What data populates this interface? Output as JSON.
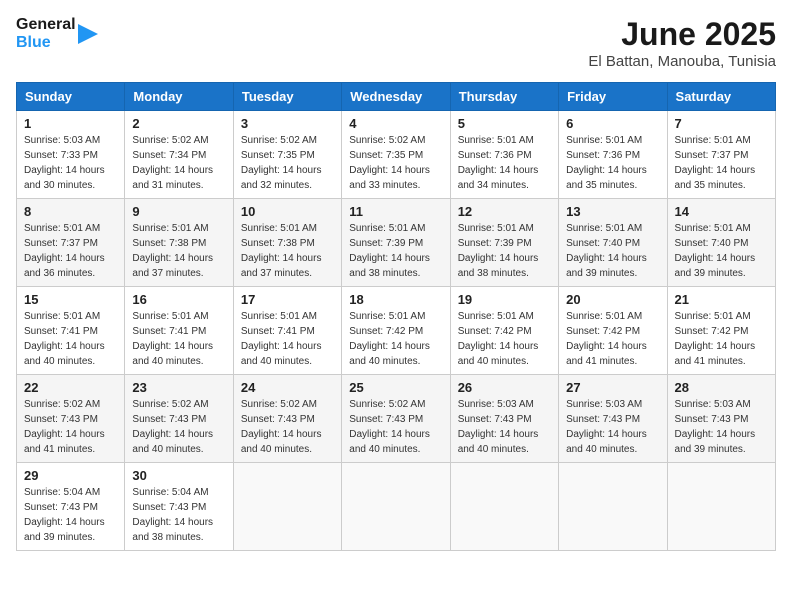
{
  "logo": {
    "line1": "General",
    "line2": "Blue"
  },
  "title": "June 2025",
  "subtitle": "El Battan, Manouba, Tunisia",
  "weekdays": [
    "Sunday",
    "Monday",
    "Tuesday",
    "Wednesday",
    "Thursday",
    "Friday",
    "Saturday"
  ],
  "weeks": [
    [
      {
        "day": "1",
        "sunrise": "5:03 AM",
        "sunset": "7:33 PM",
        "daylight": "14 hours and 30 minutes."
      },
      {
        "day": "2",
        "sunrise": "5:02 AM",
        "sunset": "7:34 PM",
        "daylight": "14 hours and 31 minutes."
      },
      {
        "day": "3",
        "sunrise": "5:02 AM",
        "sunset": "7:35 PM",
        "daylight": "14 hours and 32 minutes."
      },
      {
        "day": "4",
        "sunrise": "5:02 AM",
        "sunset": "7:35 PM",
        "daylight": "14 hours and 33 minutes."
      },
      {
        "day": "5",
        "sunrise": "5:01 AM",
        "sunset": "7:36 PM",
        "daylight": "14 hours and 34 minutes."
      },
      {
        "day": "6",
        "sunrise": "5:01 AM",
        "sunset": "7:36 PM",
        "daylight": "14 hours and 35 minutes."
      },
      {
        "day": "7",
        "sunrise": "5:01 AM",
        "sunset": "7:37 PM",
        "daylight": "14 hours and 35 minutes."
      }
    ],
    [
      {
        "day": "8",
        "sunrise": "5:01 AM",
        "sunset": "7:37 PM",
        "daylight": "14 hours and 36 minutes."
      },
      {
        "day": "9",
        "sunrise": "5:01 AM",
        "sunset": "7:38 PM",
        "daylight": "14 hours and 37 minutes."
      },
      {
        "day": "10",
        "sunrise": "5:01 AM",
        "sunset": "7:38 PM",
        "daylight": "14 hours and 37 minutes."
      },
      {
        "day": "11",
        "sunrise": "5:01 AM",
        "sunset": "7:39 PM",
        "daylight": "14 hours and 38 minutes."
      },
      {
        "day": "12",
        "sunrise": "5:01 AM",
        "sunset": "7:39 PM",
        "daylight": "14 hours and 38 minutes."
      },
      {
        "day": "13",
        "sunrise": "5:01 AM",
        "sunset": "7:40 PM",
        "daylight": "14 hours and 39 minutes."
      },
      {
        "day": "14",
        "sunrise": "5:01 AM",
        "sunset": "7:40 PM",
        "daylight": "14 hours and 39 minutes."
      }
    ],
    [
      {
        "day": "15",
        "sunrise": "5:01 AM",
        "sunset": "7:41 PM",
        "daylight": "14 hours and 40 minutes."
      },
      {
        "day": "16",
        "sunrise": "5:01 AM",
        "sunset": "7:41 PM",
        "daylight": "14 hours and 40 minutes."
      },
      {
        "day": "17",
        "sunrise": "5:01 AM",
        "sunset": "7:41 PM",
        "daylight": "14 hours and 40 minutes."
      },
      {
        "day": "18",
        "sunrise": "5:01 AM",
        "sunset": "7:42 PM",
        "daylight": "14 hours and 40 minutes."
      },
      {
        "day": "19",
        "sunrise": "5:01 AM",
        "sunset": "7:42 PM",
        "daylight": "14 hours and 40 minutes."
      },
      {
        "day": "20",
        "sunrise": "5:01 AM",
        "sunset": "7:42 PM",
        "daylight": "14 hours and 41 minutes."
      },
      {
        "day": "21",
        "sunrise": "5:01 AM",
        "sunset": "7:42 PM",
        "daylight": "14 hours and 41 minutes."
      }
    ],
    [
      {
        "day": "22",
        "sunrise": "5:02 AM",
        "sunset": "7:43 PM",
        "daylight": "14 hours and 41 minutes."
      },
      {
        "day": "23",
        "sunrise": "5:02 AM",
        "sunset": "7:43 PM",
        "daylight": "14 hours and 40 minutes."
      },
      {
        "day": "24",
        "sunrise": "5:02 AM",
        "sunset": "7:43 PM",
        "daylight": "14 hours and 40 minutes."
      },
      {
        "day": "25",
        "sunrise": "5:02 AM",
        "sunset": "7:43 PM",
        "daylight": "14 hours and 40 minutes."
      },
      {
        "day": "26",
        "sunrise": "5:03 AM",
        "sunset": "7:43 PM",
        "daylight": "14 hours and 40 minutes."
      },
      {
        "day": "27",
        "sunrise": "5:03 AM",
        "sunset": "7:43 PM",
        "daylight": "14 hours and 40 minutes."
      },
      {
        "day": "28",
        "sunrise": "5:03 AM",
        "sunset": "7:43 PM",
        "daylight": "14 hours and 39 minutes."
      }
    ],
    [
      {
        "day": "29",
        "sunrise": "5:04 AM",
        "sunset": "7:43 PM",
        "daylight": "14 hours and 39 minutes."
      },
      {
        "day": "30",
        "sunrise": "5:04 AM",
        "sunset": "7:43 PM",
        "daylight": "14 hours and 38 minutes."
      },
      null,
      null,
      null,
      null,
      null
    ]
  ]
}
